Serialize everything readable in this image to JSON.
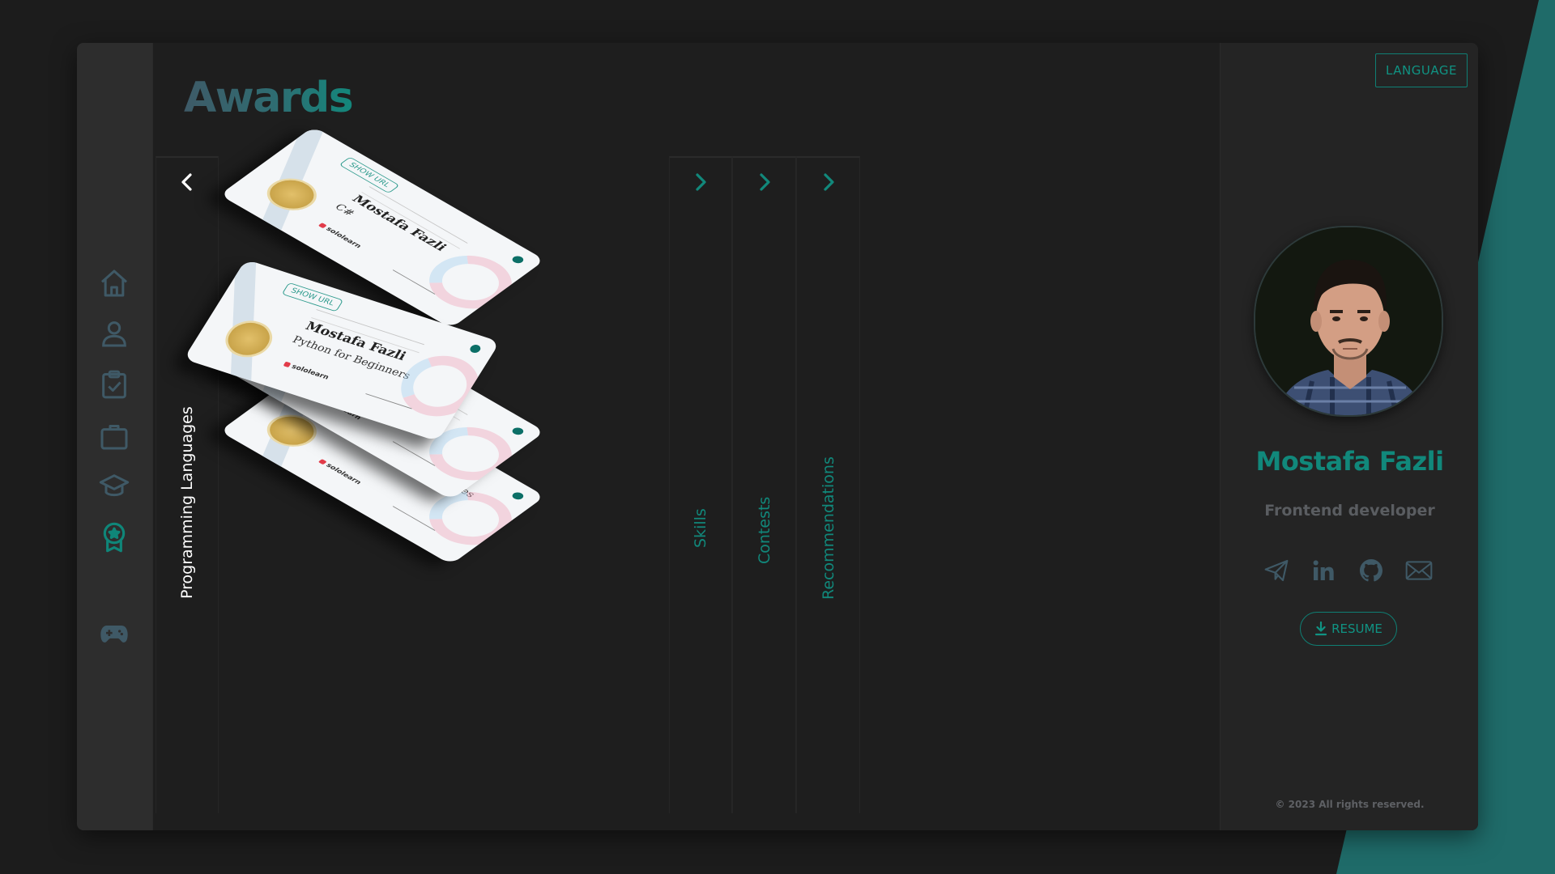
{
  "page": {
    "title": "Awards"
  },
  "sidebar": {
    "items": [
      {
        "icon": "home-icon",
        "active": false
      },
      {
        "icon": "user-icon",
        "active": false
      },
      {
        "icon": "clipboard-check-icon",
        "active": false
      },
      {
        "icon": "briefcase-icon",
        "active": false
      },
      {
        "icon": "graduation-cap-icon",
        "active": false
      },
      {
        "icon": "award-icon",
        "active": true
      },
      {
        "icon": "gamepad-icon",
        "active": false
      }
    ]
  },
  "tabs": [
    {
      "label": "Programming Languages",
      "active": true
    },
    {
      "label": "Skills",
      "active": false
    },
    {
      "label": "Contests",
      "active": false
    },
    {
      "label": "Recommendations",
      "active": false
    }
  ],
  "certificates": [
    {
      "name": "Mostafa Fazli",
      "course": "C#",
      "show_url": "SHOW URL",
      "brand": "sololearn"
    },
    {
      "name": "Mostafa Fazli",
      "course": "Python for Beginners",
      "show_url": "SHOW URL",
      "brand": "sololearn"
    },
    {
      "name": "",
      "course": "",
      "show_url": "",
      "brand": "sololearn"
    },
    {
      "name": "",
      "course": "Python Data Structures",
      "show_url": "",
      "brand": "sololearn"
    }
  ],
  "profile": {
    "language_button": "LANGUAGE",
    "name": "Mostafa Fazli",
    "role": "Frontend developer",
    "socials": [
      "telegram-icon",
      "linkedin-icon",
      "github-icon",
      "mail-icon"
    ],
    "resume_label": "RESUME",
    "copyright": "© 2023 All rights reserved."
  },
  "colors": {
    "accent": "#11887b",
    "background": "#1c1c1c",
    "sidebar": "#2d2d2d",
    "panel": "#242424",
    "icon_muted": "#3f5966"
  }
}
